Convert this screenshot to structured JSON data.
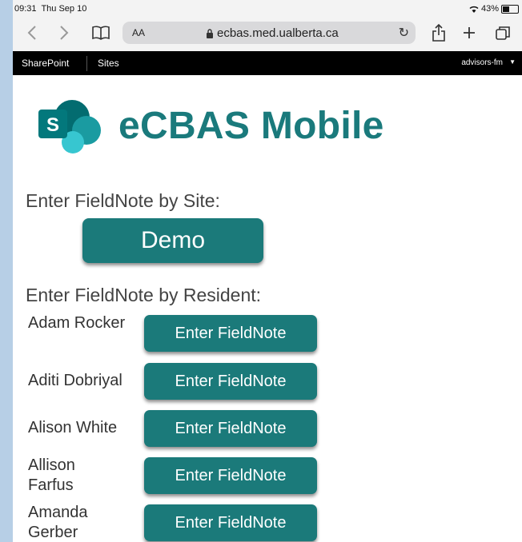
{
  "status": {
    "time": "09:31",
    "date": "Thu Sep 10",
    "battery": "43%"
  },
  "browser": {
    "text_size_label": "AA",
    "url": "ecbas.med.ualberta.ca",
    "icons": [
      "back-icon",
      "forward-icon",
      "bookmarks-icon",
      "lock-icon",
      "reload-icon",
      "share-icon",
      "new-tab-icon",
      "tabs-icon"
    ]
  },
  "sharepoint": {
    "home_label": "SharePoint",
    "sites_label": "Sites",
    "user_label": "advisors-fm"
  },
  "app": {
    "title": "eCBAS Mobile",
    "brand_color": "#1b7a7a"
  },
  "by_site": {
    "heading": "Enter FieldNote by Site:",
    "button_label": "Demo"
  },
  "by_resident": {
    "heading": "Enter FieldNote by Resident:",
    "residents": [
      {
        "name": "Adam Rocker",
        "button_label": "Enter FieldNote"
      },
      {
        "name": "Aditi Dobriyal",
        "button_label": "Enter FieldNote"
      },
      {
        "name": "Alison White",
        "button_label": "Enter FieldNote"
      },
      {
        "name": "Allison Farfus",
        "button_label": "Enter FieldNote"
      },
      {
        "name": "Amanda Gerber",
        "button_label": "Enter FieldNote"
      }
    ]
  }
}
